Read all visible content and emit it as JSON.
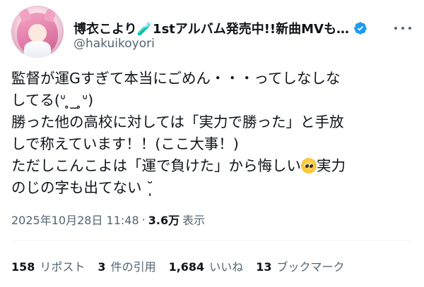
{
  "header": {
    "display_name": "博衣こより🧪1stアルバム発売中!!新曲MVも…",
    "handle": "@hakuikoyori",
    "verified_color": "#1d9bf0"
  },
  "tweet": {
    "line1": "監督が運Gすぎて本当にごめん・・・ってしなしな",
    "line2": "してる(ᐡ ̥_ ̥ᐡ)",
    "line3": "勝った他の高校に対しては「実力で勝った」と手放",
    "line4": "しで称えています！！(ここ大事！)",
    "line5a": "ただしこんこよは「運で負けた」から悔しい",
    "emoji_name": "pleading-face",
    "line5b": "実力",
    "line6": "のじの字も出てない ˘̩̩̩ "
  },
  "meta": {
    "timestamp": "2025年10月28日 11:48",
    "separator": "·",
    "views_count": "3.6万",
    "views_label": "表示"
  },
  "stats": {
    "reposts_count": "158",
    "reposts_label": "リポスト",
    "quotes_count": "3",
    "quotes_label": "件の引用",
    "likes_count": "1,684",
    "likes_label": "いいね",
    "bookmarks_count": "13",
    "bookmarks_label": "ブックマーク"
  },
  "icons": {
    "more": "more-options-icon",
    "verified": "verified-badge-icon"
  }
}
